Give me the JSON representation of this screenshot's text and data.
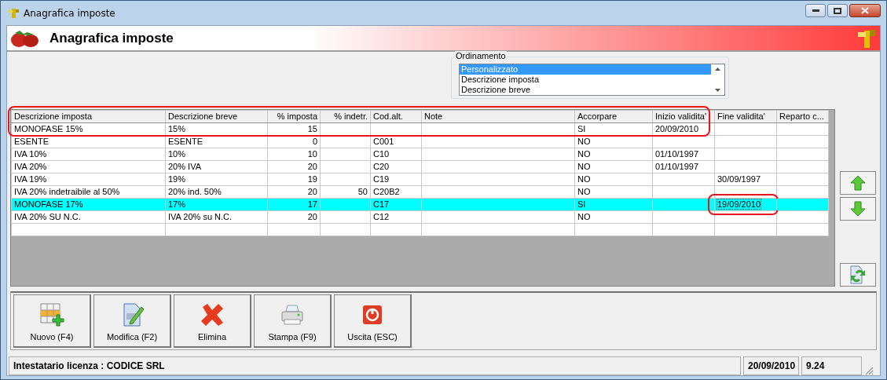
{
  "window": {
    "title": "Anagrafica imposte"
  },
  "header": {
    "title": "Anagrafica imposte"
  },
  "ordering": {
    "label": "Ordinamento",
    "items": [
      {
        "label": "Personalizzato",
        "selected": true
      },
      {
        "label": "Descrizione imposta",
        "selected": false
      },
      {
        "label": "Descrizione breve",
        "selected": false
      }
    ]
  },
  "table": {
    "columns": [
      "Descrizione imposta",
      "Descrizione breve",
      "% imposta",
      "% indetr.",
      "Cod.alt.",
      "Note",
      "Accorpare",
      "Inizio validita'",
      "Fine validita'",
      "Reparto c..."
    ],
    "rows": [
      {
        "cells": [
          "MONOFASE 15%",
          "15%",
          "15",
          null,
          null,
          null,
          "SI",
          "20/09/2010",
          null,
          null
        ],
        "selected": false
      },
      {
        "cells": [
          "ESENTE",
          "ESENTE",
          "0",
          null,
          "C001",
          null,
          "NO",
          null,
          null,
          null
        ],
        "selected": false
      },
      {
        "cells": [
          "IVA 10%",
          "10%",
          "10",
          null,
          "C10",
          null,
          "NO",
          "01/10/1997",
          null,
          null
        ],
        "selected": false
      },
      {
        "cells": [
          "IVA 20%",
          "20% IVA",
          "20",
          null,
          "C20",
          null,
          "NO",
          "01/10/1997",
          null,
          null
        ],
        "selected": false
      },
      {
        "cells": [
          "IVA 19%",
          "19%",
          "19",
          null,
          "C19",
          null,
          "NO",
          null,
          "30/09/1997",
          null
        ],
        "selected": false
      },
      {
        "cells": [
          "IVA 20% indetraibile al 50%",
          "20% ind. 50%",
          "20",
          "50",
          "C20B2",
          null,
          "NO",
          null,
          null,
          null
        ],
        "selected": false
      },
      {
        "cells": [
          "MONOFASE 17%",
          "17%",
          "17",
          null,
          "C17",
          null,
          "SI",
          null,
          "19/09/2010",
          null
        ],
        "selected": true
      },
      {
        "cells": [
          "IVA 20% SU N.C.",
          "IVA 20% su N.C.",
          "20",
          null,
          "C12",
          null,
          "NO",
          null,
          null,
          null
        ],
        "selected": false
      }
    ]
  },
  "toolbar": [
    {
      "label": "Nuovo (F4)",
      "kind": "new"
    },
    {
      "label": "Modifica (F2)",
      "kind": "edit"
    },
    {
      "label": "Elimina",
      "kind": "delete"
    },
    {
      "label": "Stampa (F9)",
      "kind": "print"
    },
    {
      "label": "Uscita (ESC)",
      "kind": "exit"
    }
  ],
  "status_bar": {
    "license": "Intestatario licenza : CODICE SRL",
    "date": "20/09/2010",
    "version": "9.24"
  }
}
